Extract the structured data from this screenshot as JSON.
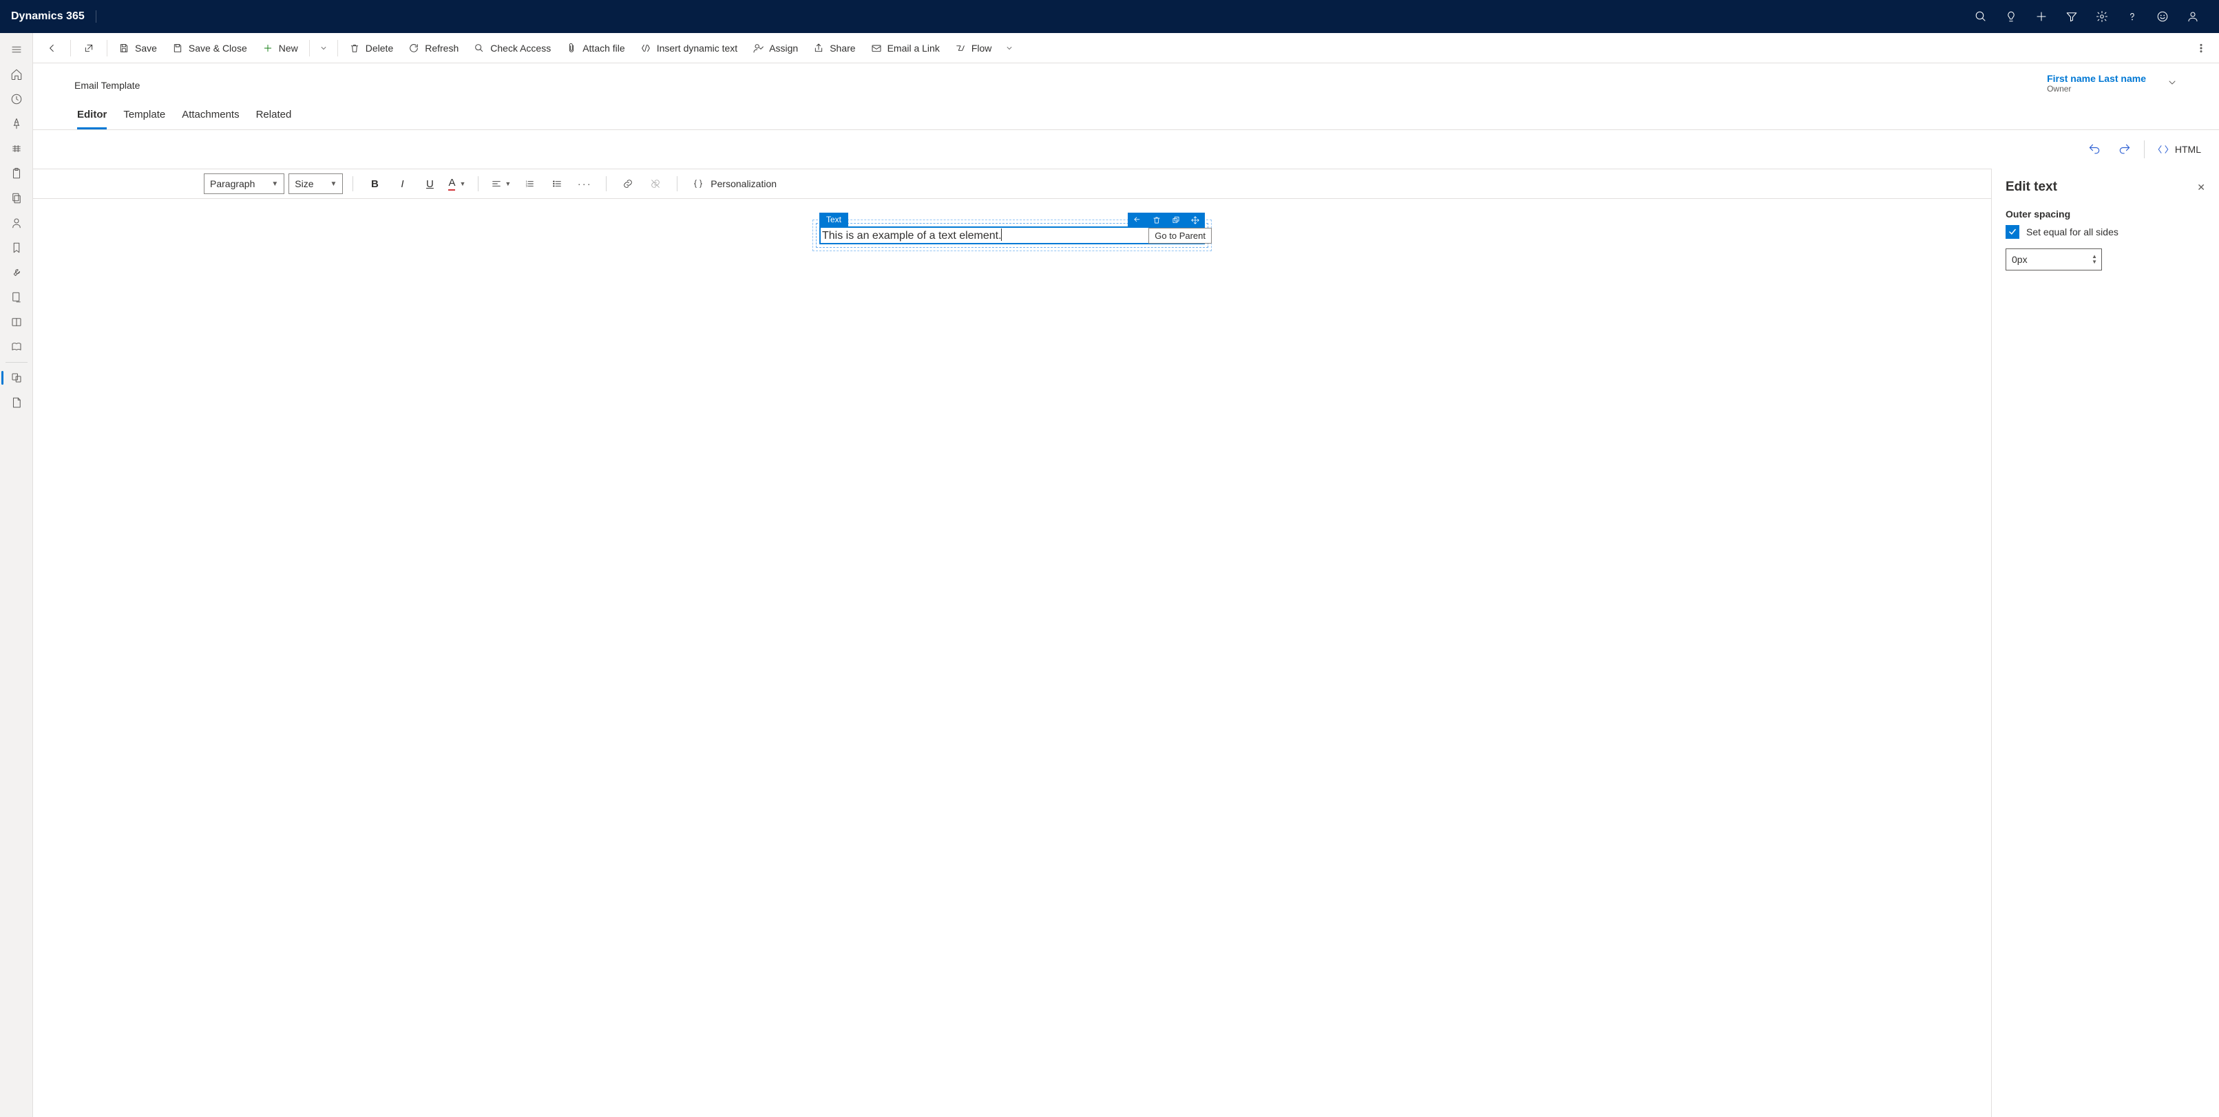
{
  "app": {
    "name": "Dynamics 365"
  },
  "commands": {
    "save": "Save",
    "save_close": "Save & Close",
    "new": "New",
    "delete": "Delete",
    "refresh": "Refresh",
    "check_access": "Check Access",
    "attach_file": "Attach file",
    "insert_dynamic": "Insert dynamic text",
    "assign": "Assign",
    "share": "Share",
    "email_link": "Email a Link",
    "flow": "Flow"
  },
  "record": {
    "entity": "Email Template",
    "owner_name": "First name Last name",
    "owner_label": "Owner"
  },
  "tabs": [
    "Editor",
    "Template",
    "Attachments",
    "Related"
  ],
  "active_tab": "Editor",
  "editor_actions": {
    "html": "HTML"
  },
  "rte": {
    "style_dd": "Paragraph",
    "size_dd": "Size",
    "personalization": "Personalization"
  },
  "selection": {
    "badge": "Text",
    "content": "This is an example of a text element.",
    "tooltip": "Go to Parent"
  },
  "panel": {
    "title": "Edit text",
    "outer_spacing_label": "Outer spacing",
    "equal_sides_label": "Set equal for all sides",
    "spacing_value": "0px"
  }
}
